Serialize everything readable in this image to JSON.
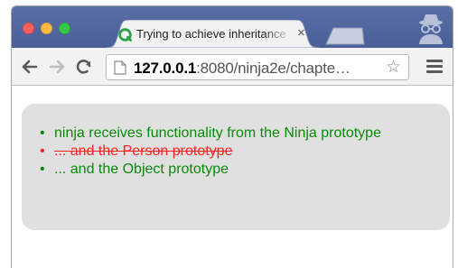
{
  "browser": {
    "tab": {
      "title": "Trying to achieve inheritance",
      "close_glyph": "×",
      "favicon": "qunit-icon"
    },
    "toolbar": {
      "url_host": "127.0.0.1",
      "url_rest": ":8080/ninja2e/chapte…",
      "bookmark_glyph": "☆"
    },
    "colors": {
      "tabstrip": "#4a5f98",
      "pass": "#0a8a0a",
      "fail": "#ff2020",
      "result_box": "#e0e0e0"
    }
  },
  "page": {
    "results": [
      {
        "status": "pass",
        "bullet": "•",
        "text": "ninja receives functionality from the Ninja prototype"
      },
      {
        "status": "fail",
        "bullet": "•",
        "text": "... and the Person prototype"
      },
      {
        "status": "pass",
        "bullet": "•",
        "text": "... and the Object prototype"
      }
    ]
  }
}
